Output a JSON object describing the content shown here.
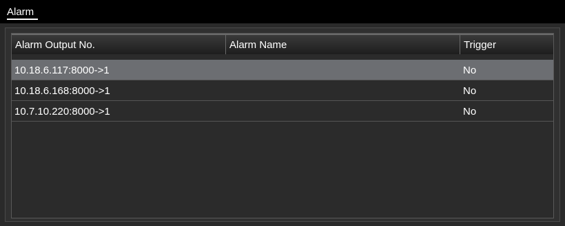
{
  "window": {
    "title": "Alarm"
  },
  "table": {
    "columns": [
      "Alarm Output No.",
      "Alarm Name",
      "Trigger"
    ],
    "rows": [
      {
        "output_no": "10.18.6.117:8000->1",
        "name": "",
        "trigger": "No",
        "selected": true
      },
      {
        "output_no": "10.18.6.168:8000->1",
        "name": "",
        "trigger": "No",
        "selected": false
      },
      {
        "output_no": "10.7.10.220:8000->1",
        "name": "",
        "trigger": "No",
        "selected": false
      }
    ]
  },
  "colors": {
    "titlebar": "#000000",
    "panel": "#303030",
    "selected_row": "#6c6e72"
  }
}
